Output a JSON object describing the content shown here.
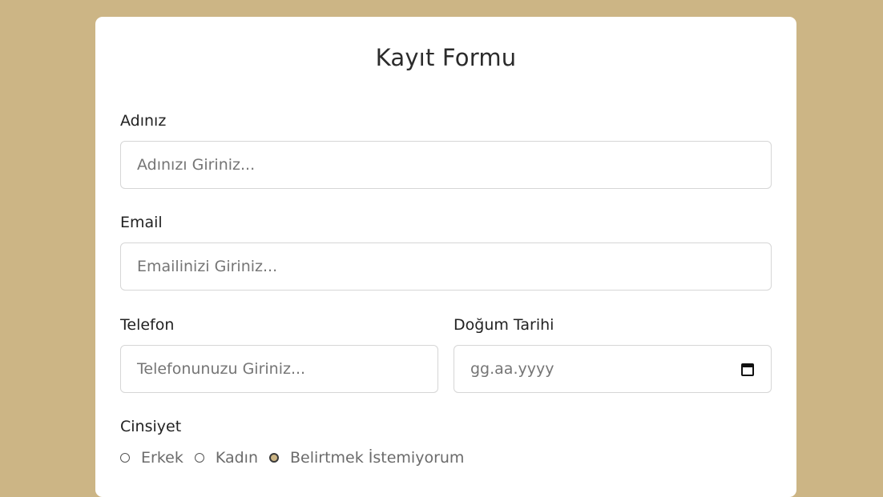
{
  "form": {
    "title": "Kayıt Formu",
    "name": {
      "label": "Adınız",
      "placeholder": "Adınızı Giriniz..."
    },
    "email": {
      "label": "Email",
      "placeholder": "Emailinizi Giriniz..."
    },
    "phone": {
      "label": "Telefon",
      "placeholder": "Telefonunuzu Giriniz..."
    },
    "birthdate": {
      "label": "Doğum Tarihi",
      "placeholder": "gg.aa.yyyy",
      "icon": "calendar-icon"
    },
    "gender": {
      "label": "Cinsiyet",
      "options": [
        "Erkek",
        "Kadın",
        "Belirtmek İstemiyorum"
      ],
      "selected": "Belirtmek İstemiyorum"
    }
  },
  "colors": {
    "background": "#ccb585",
    "card": "#ffffff",
    "input_border": "#d6d6d6"
  }
}
